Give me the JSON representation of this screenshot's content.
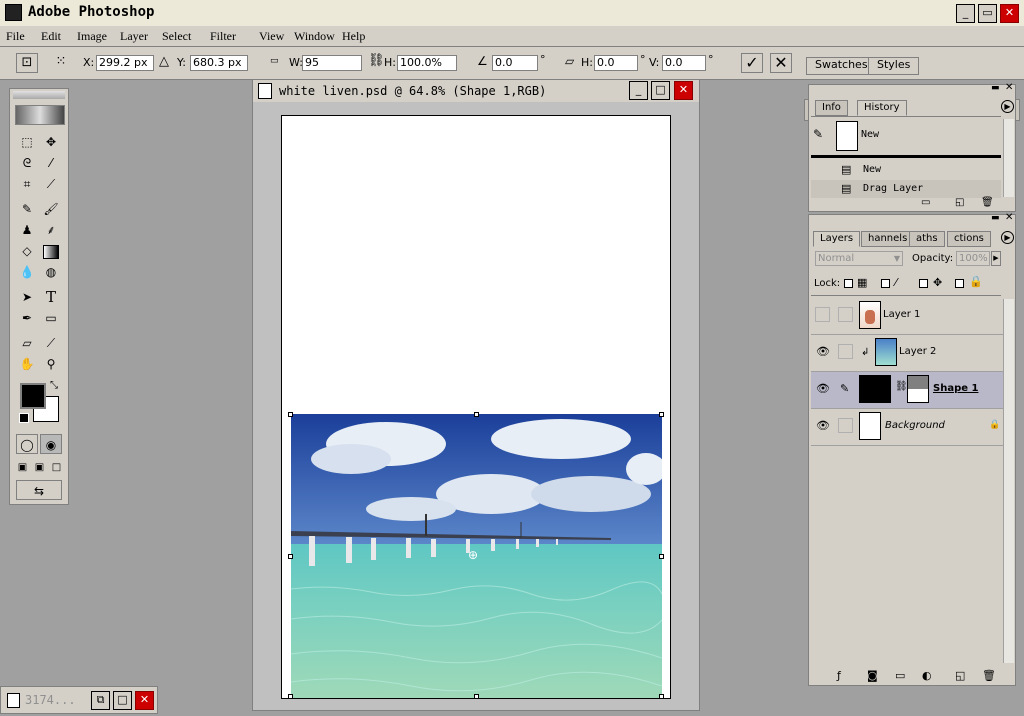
{
  "app": {
    "title": "Adobe Photoshop"
  },
  "menu": [
    "File",
    "Edit",
    "Image",
    "Layer",
    "Select",
    "Filter",
    "View",
    "Window",
    "Help"
  ],
  "options": {
    "x_label": "X:",
    "x_value": "299.2 px",
    "y_label": "Y:",
    "y_value": "680.3 px",
    "w_label": "W:",
    "w_value": "95",
    "h_label": "H:",
    "h_value": "100.0%",
    "angle_value": "0.0",
    "angle_unit": "°",
    "skew_h_label": "H:",
    "skew_h_value": "0.0",
    "skew_h_unit": "°",
    "skew_v_label": "V:",
    "skew_v_value": "0.0",
    "skew_v_unit": "°",
    "commit_icon": "checkmark-icon",
    "cancel_icon": "x-icon"
  },
  "palette_well": {
    "tabs": [
      "Swatches",
      "Styles"
    ]
  },
  "document": {
    "title": "white liven.psd @ 64.8% (Shape 1,RGB)"
  },
  "history_panel": {
    "tabs": [
      "Info",
      "History"
    ],
    "active_tab": "History",
    "snapshot_label": "New",
    "states": [
      "New",
      "Drag Layer"
    ]
  },
  "layers_panel": {
    "tabs": [
      "Layers",
      "Channels",
      "Paths",
      "Actions"
    ],
    "tab_display": [
      "Layers",
      "hannels",
      "aths",
      "ctions"
    ],
    "active_tab": "Layers",
    "blend_mode": "Normal",
    "opacity_label": "Opacity:",
    "opacity_value": "100%",
    "lock_label": "Lock:",
    "layers": [
      {
        "name": "Layer 1",
        "visible": false
      },
      {
        "name": "Layer 2",
        "visible": true
      },
      {
        "name": "Shape 1",
        "visible": true,
        "selected": true
      },
      {
        "name": "Background",
        "visible": true,
        "locked": true
      }
    ]
  },
  "minimized_doc": {
    "title": "3174..."
  },
  "colors": {
    "foreground": "#000000",
    "background": "#ffffff",
    "selection": "#b8b8c8"
  }
}
